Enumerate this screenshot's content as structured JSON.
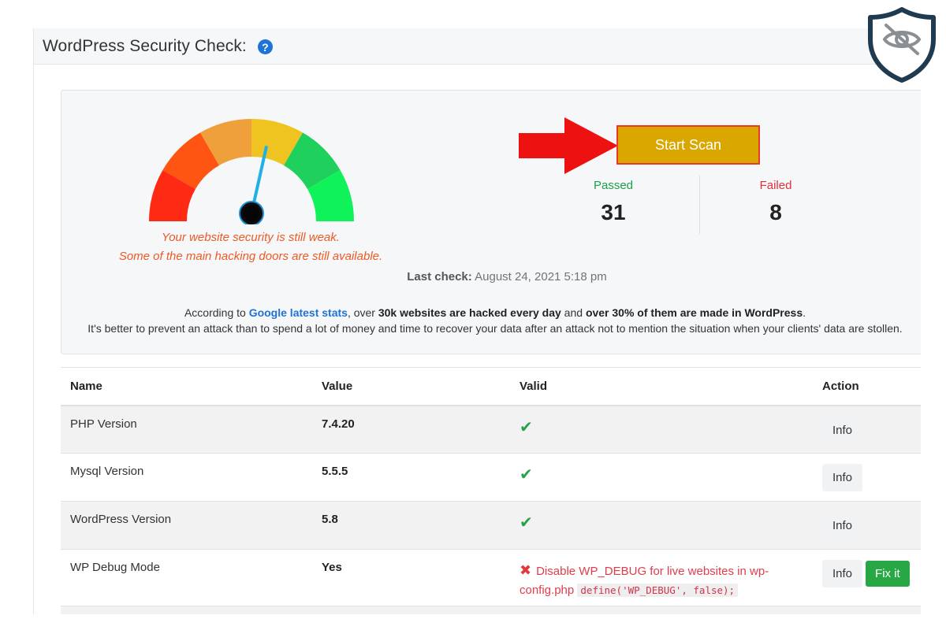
{
  "header": {
    "title": "WordPress Security Check:"
  },
  "gauge": {
    "needle_level": 0.57,
    "message_line1": "Your website security is still weak.",
    "message_line2": "Some of the main hacking doors are still available."
  },
  "scan": {
    "button_label": "Start Scan"
  },
  "stats": {
    "passed_label": "Passed",
    "passed_value": "31",
    "failed_label": "Failed",
    "failed_value": "8"
  },
  "last_check": {
    "label": "Last check:",
    "value": "August 24, 2021 5:18 pm"
  },
  "info_text": {
    "p1": "According to ",
    "link": "Google latest stats",
    "p2": ", over ",
    "b1": "30k websites are hacked every day",
    "p3": " and ",
    "b2": "over 30% of them are made in WordPress",
    "p4": ".",
    "line2": "It's better to prevent an attack than to spend a lot of money and time to recover your data after an attack not to mention the situation when your clients' data are stollen."
  },
  "table": {
    "headers": {
      "name": "Name",
      "value": "Value",
      "valid": "Valid",
      "action": "Action"
    },
    "rows": [
      {
        "name": "PHP Version",
        "value": "7.4.20",
        "valid": "check",
        "info": "Info"
      },
      {
        "name": "Mysql Version",
        "value": "5.5.5",
        "valid": "check",
        "info": "Info"
      },
      {
        "name": "WordPress Version",
        "value": "5.8",
        "valid": "check",
        "info": "Info"
      },
      {
        "name": "WP Debug Mode",
        "value": "Yes",
        "valid": "fail",
        "warn_text": "Disable WP_DEBUG for live websites in wp-config.php",
        "warn_code": "define('WP_DEBUG', false);",
        "info": "Info",
        "fix": "Fix it"
      }
    ]
  },
  "colors": {
    "accent": "#daa700",
    "passed": "#1e9e4a",
    "failed": "#e0303c",
    "arrow": "#ee1111",
    "shield": "#1f3b52"
  },
  "icons": {
    "help": "question-circle-icon",
    "arrow": "arrow-right-icon",
    "shield": "shield-eye-slash-icon"
  }
}
